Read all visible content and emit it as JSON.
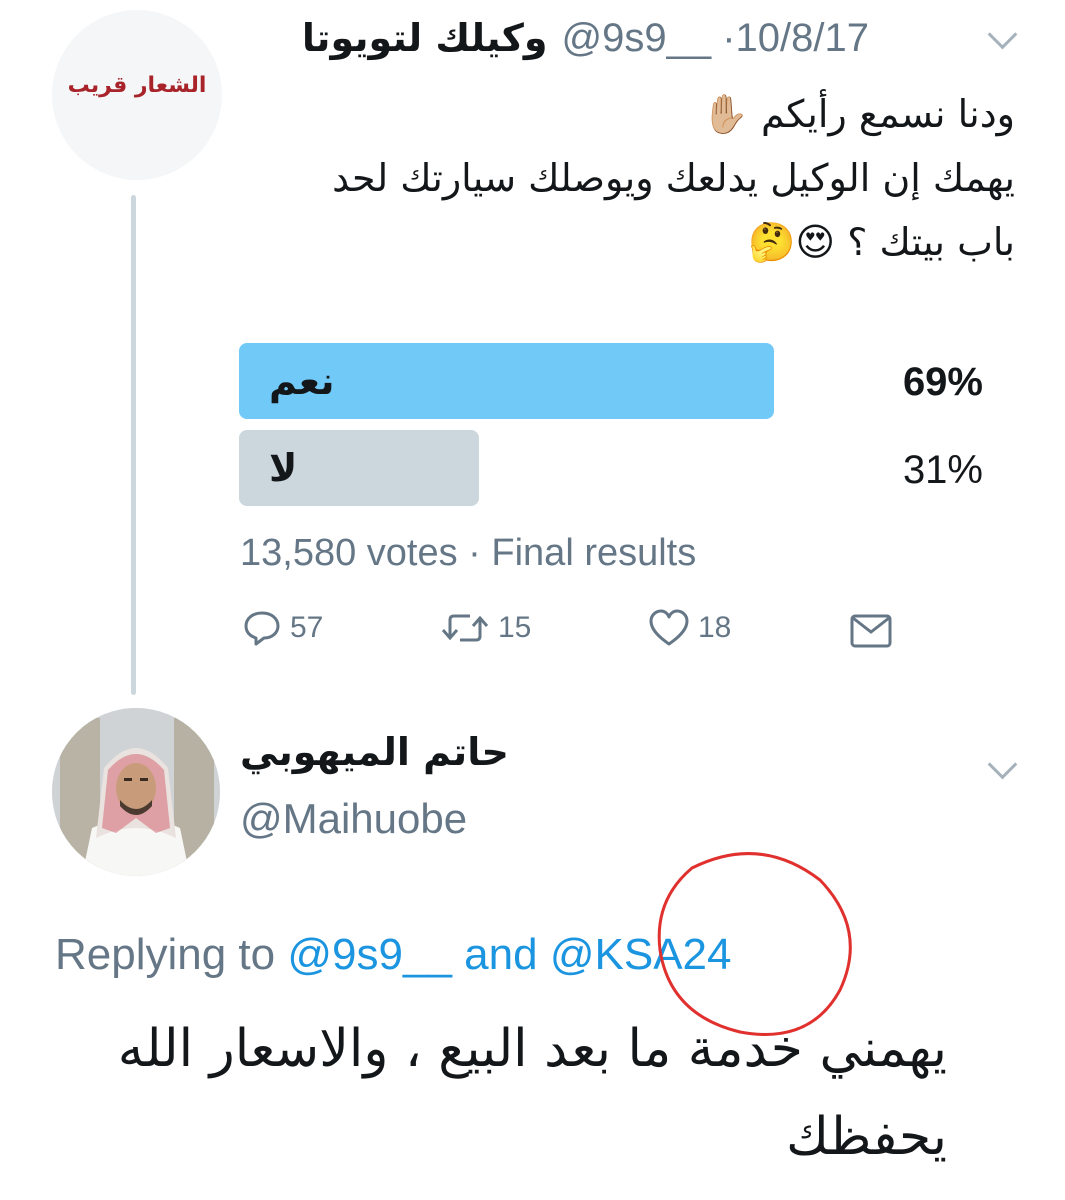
{
  "tweet": {
    "avatar_text": "الشعار قريب",
    "display_name": "وكيلك لتويوتا",
    "handle": "@9s9__",
    "date": "10/8/17",
    "lines": [
      {
        "text": "ودنا نسمع رأيكم",
        "emoji": "✋🏼"
      },
      {
        "text": "يهمك إن الوكيل يدلعك ويوصلك سيارتك لحد",
        "emoji": ""
      },
      {
        "text": "باب بيتك ؟",
        "emoji": "😍🤔"
      }
    ],
    "poll": {
      "options": [
        {
          "label": "نعم",
          "percent_text": "69%",
          "percent": 69,
          "leading": true
        },
        {
          "label": "لا",
          "percent_text": "31%",
          "percent": 31,
          "leading": false
        }
      ],
      "votes": "13,580 votes",
      "status": "Final results"
    },
    "actions": {
      "replies": "57",
      "retweets": "15",
      "likes": "18"
    }
  },
  "reply": {
    "display_name": "حاتم الميهوبي",
    "handle": "@Maihuobe",
    "replying_prefix": "Replying to",
    "mention1": "@9s9__",
    "and_text": "and",
    "mention2": "@KSA24",
    "text": "يهمني خدمة ما بعد البيع ، والاسعار الله يحفظك"
  },
  "colors": {
    "accent": "#1b95e0",
    "poll_leading": "#71c9f8",
    "poll_other": "#ccd6dd",
    "muted": "#657786",
    "annotation": "#e0312e"
  }
}
